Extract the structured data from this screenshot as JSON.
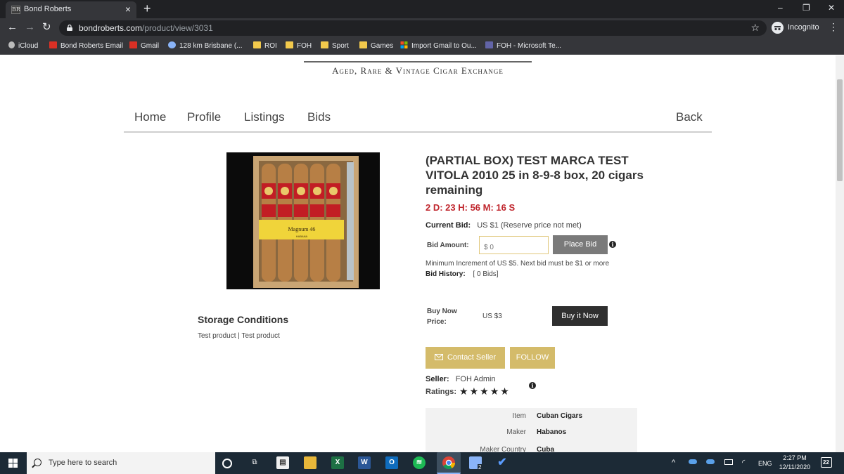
{
  "browser": {
    "tab_title": "Bond Roberts",
    "tab_favicon": "BR",
    "url_domain": "bondroberts.com",
    "url_path": "/product/view/3031",
    "incognito_label": "Incognito",
    "bookmarks": [
      {
        "label": "iCloud",
        "icon": "apple-icon",
        "color": "#cccccc"
      },
      {
        "label": "Bond Roberts Email",
        "icon": "gmail-icon",
        "color": "#d93025"
      },
      {
        "label": "Gmail",
        "icon": "gmail-icon",
        "color": "#d93025"
      },
      {
        "label": "128 km Brisbane (...",
        "icon": "globe-icon",
        "color": "#8ab4f8"
      },
      {
        "label": "ROI",
        "icon": "folder-icon",
        "color": "#f2c94c"
      },
      {
        "label": "FOH",
        "icon": "folder-icon",
        "color": "#f2c94c"
      },
      {
        "label": "Sport",
        "icon": "folder-icon",
        "color": "#f2c94c"
      },
      {
        "label": "Games",
        "icon": "folder-icon",
        "color": "#f2c94c"
      },
      {
        "label": "Import Gmail to Ou...",
        "icon": "microsoft-icon",
        "color": "#7fba00"
      },
      {
        "label": "FOH - Microsoft Te...",
        "icon": "teams-icon",
        "color": "#6264a7"
      }
    ]
  },
  "site": {
    "tagline": "Aged, Rare & Vintage Cigar Exchange",
    "nav": {
      "home": "Home",
      "profile": "Profile",
      "listings": "Listings",
      "bids": "Bids",
      "back": "Back"
    }
  },
  "product": {
    "title": "(PARTIAL BOX) TEST MARCA TEST VITOLA 2010 25 in 8-9-8 box, 20 cigars remaining",
    "countdown": "2 D: 23 H: 56 M: 16 S",
    "current_bid_label": "Current Bid:",
    "current_bid_value": "US $1 (Reserve price not met)",
    "bid_amount_label": "Bid Amount:",
    "bid_placeholder": "$ 0",
    "place_bid_label": "Place Bid",
    "min_increment_text": "Minimum Increment of US $5. Next bid must be $1 or more",
    "bid_history_label": "Bid History:",
    "bid_history_value": "[ 0 Bids]",
    "buy_now_label_line1": "Buy Now",
    "buy_now_label_line2": "Price:",
    "buy_now_price": "US $3",
    "buy_it_now_label": "Buy it Now",
    "contact_seller_label": "Contact Seller",
    "follow_label": "FOLLOW",
    "seller_label": "Seller:",
    "seller_name": "FOH Admin",
    "ratings_label": "Ratings:",
    "rating_stars": 5,
    "image_band_text": "Magnum 46",
    "image_band_sub": "HABANA",
    "storage_title": "Storage Conditions",
    "storage_text": "Test product | Test product",
    "specs": [
      {
        "key": "Item",
        "value": "Cuban Cigars"
      },
      {
        "key": "Maker",
        "value": "Habanos"
      },
      {
        "key": "Maker Country",
        "value": "Cuba"
      }
    ]
  },
  "taskbar": {
    "search_placeholder": "Type here to search",
    "language": "ENG",
    "time": "2:27 PM",
    "date": "12/11/2020",
    "notification_count": "22",
    "chrome_badge": "2"
  },
  "colors": {
    "accent_gold": "#d4bb6a",
    "countdown_red": "#c0262d"
  }
}
